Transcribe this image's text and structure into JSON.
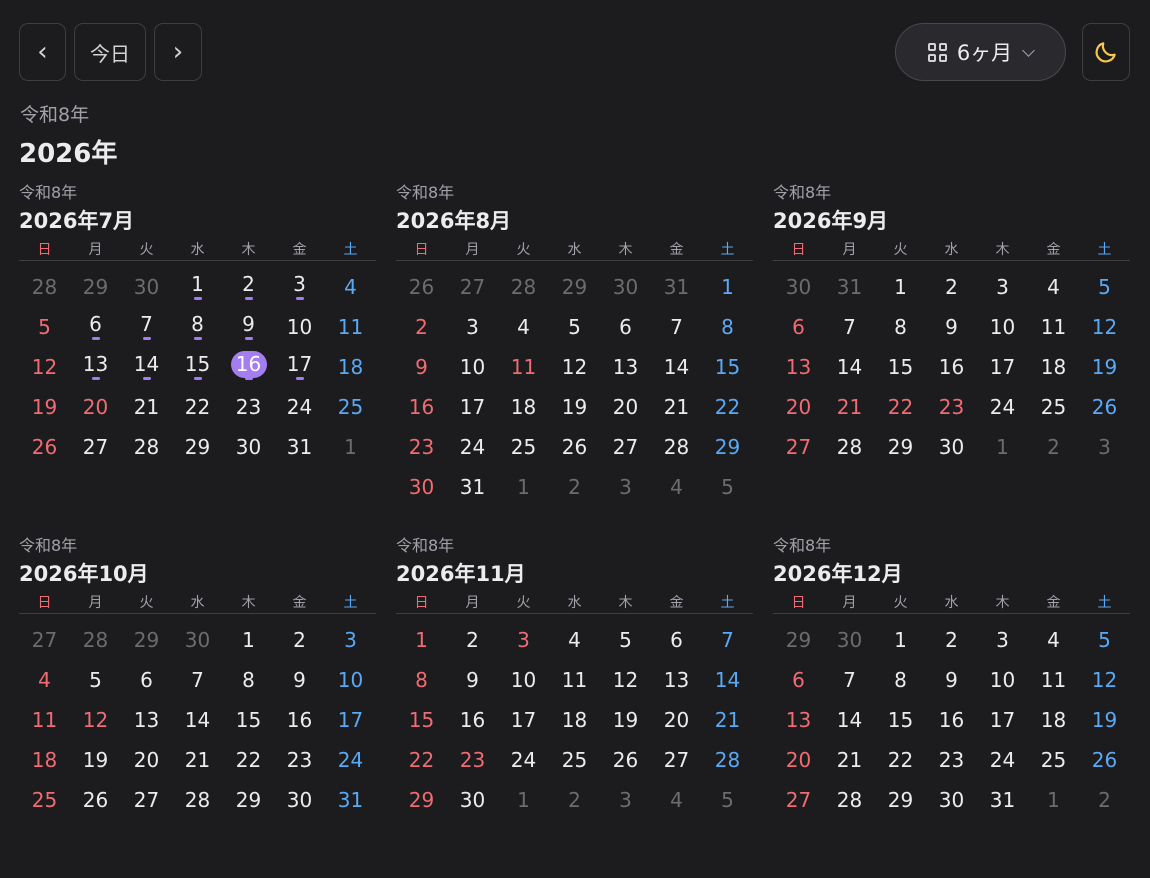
{
  "toolbar": {
    "prev_label": "‹",
    "today_label": "今日",
    "next_label": "›",
    "view_label": "6ヶ月",
    "view_icon": "grid-icon",
    "theme_icon": "moon-icon",
    "theme_icon_color": "#f5c84a"
  },
  "header": {
    "era": "令和8年",
    "year": "2026年"
  },
  "weekdays": [
    "日",
    "月",
    "火",
    "水",
    "木",
    "金",
    "土"
  ],
  "colors": {
    "sunday_holiday": "#f06b73",
    "saturday": "#5aa9f5",
    "accent": "#a47ef0",
    "background": "#1c1c1e"
  },
  "months": [
    {
      "era": "令和8年",
      "title": "2026年7月",
      "days": [
        {
          "d": "28",
          "t": "out"
        },
        {
          "d": "29",
          "t": "out"
        },
        {
          "d": "30",
          "t": "out"
        },
        {
          "d": "1",
          "t": "",
          "ev": true
        },
        {
          "d": "2",
          "t": "",
          "ev": true
        },
        {
          "d": "3",
          "t": "",
          "ev": true
        },
        {
          "d": "4",
          "t": "sat"
        },
        {
          "d": "5",
          "t": "sun"
        },
        {
          "d": "6",
          "t": "",
          "ev": true
        },
        {
          "d": "7",
          "t": "",
          "ev": true
        },
        {
          "d": "8",
          "t": "",
          "ev": true
        },
        {
          "d": "9",
          "t": "",
          "ev": true
        },
        {
          "d": "10",
          "t": ""
        },
        {
          "d": "11",
          "t": "sat"
        },
        {
          "d": "12",
          "t": "sun"
        },
        {
          "d": "13",
          "t": "",
          "ev": true
        },
        {
          "d": "14",
          "t": "",
          "ev": true
        },
        {
          "d": "15",
          "t": "",
          "ev": true
        },
        {
          "d": "16",
          "t": "today",
          "ev": true
        },
        {
          "d": "17",
          "t": "",
          "ev": true
        },
        {
          "d": "18",
          "t": "sat"
        },
        {
          "d": "19",
          "t": "sun"
        },
        {
          "d": "20",
          "t": "hol"
        },
        {
          "d": "21",
          "t": ""
        },
        {
          "d": "22",
          "t": ""
        },
        {
          "d": "23",
          "t": ""
        },
        {
          "d": "24",
          "t": ""
        },
        {
          "d": "25",
          "t": "sat"
        },
        {
          "d": "26",
          "t": "sun"
        },
        {
          "d": "27",
          "t": ""
        },
        {
          "d": "28",
          "t": ""
        },
        {
          "d": "29",
          "t": ""
        },
        {
          "d": "30",
          "t": ""
        },
        {
          "d": "31",
          "t": ""
        },
        {
          "d": "1",
          "t": "out"
        }
      ]
    },
    {
      "era": "令和8年",
      "title": "2026年8月",
      "days": [
        {
          "d": "26",
          "t": "out"
        },
        {
          "d": "27",
          "t": "out"
        },
        {
          "d": "28",
          "t": "out"
        },
        {
          "d": "29",
          "t": "out"
        },
        {
          "d": "30",
          "t": "out"
        },
        {
          "d": "31",
          "t": "out"
        },
        {
          "d": "1",
          "t": "sat"
        },
        {
          "d": "2",
          "t": "sun"
        },
        {
          "d": "3",
          "t": ""
        },
        {
          "d": "4",
          "t": ""
        },
        {
          "d": "5",
          "t": ""
        },
        {
          "d": "6",
          "t": ""
        },
        {
          "d": "7",
          "t": ""
        },
        {
          "d": "8",
          "t": "sat"
        },
        {
          "d": "9",
          "t": "sun"
        },
        {
          "d": "10",
          "t": ""
        },
        {
          "d": "11",
          "t": "hol"
        },
        {
          "d": "12",
          "t": ""
        },
        {
          "d": "13",
          "t": ""
        },
        {
          "d": "14",
          "t": ""
        },
        {
          "d": "15",
          "t": "sat"
        },
        {
          "d": "16",
          "t": "sun"
        },
        {
          "d": "17",
          "t": ""
        },
        {
          "d": "18",
          "t": ""
        },
        {
          "d": "19",
          "t": ""
        },
        {
          "d": "20",
          "t": ""
        },
        {
          "d": "21",
          "t": ""
        },
        {
          "d": "22",
          "t": "sat"
        },
        {
          "d": "23",
          "t": "sun"
        },
        {
          "d": "24",
          "t": ""
        },
        {
          "d": "25",
          "t": ""
        },
        {
          "d": "26",
          "t": ""
        },
        {
          "d": "27",
          "t": ""
        },
        {
          "d": "28",
          "t": ""
        },
        {
          "d": "29",
          "t": "sat"
        },
        {
          "d": "30",
          "t": "sun"
        },
        {
          "d": "31",
          "t": ""
        },
        {
          "d": "1",
          "t": "out"
        },
        {
          "d": "2",
          "t": "out"
        },
        {
          "d": "3",
          "t": "out"
        },
        {
          "d": "4",
          "t": "out"
        },
        {
          "d": "5",
          "t": "out"
        }
      ]
    },
    {
      "era": "令和8年",
      "title": "2026年9月",
      "days": [
        {
          "d": "30",
          "t": "out"
        },
        {
          "d": "31",
          "t": "out"
        },
        {
          "d": "1",
          "t": ""
        },
        {
          "d": "2",
          "t": ""
        },
        {
          "d": "3",
          "t": ""
        },
        {
          "d": "4",
          "t": ""
        },
        {
          "d": "5",
          "t": "sat"
        },
        {
          "d": "6",
          "t": "sun"
        },
        {
          "d": "7",
          "t": ""
        },
        {
          "d": "8",
          "t": ""
        },
        {
          "d": "9",
          "t": ""
        },
        {
          "d": "10",
          "t": ""
        },
        {
          "d": "11",
          "t": ""
        },
        {
          "d": "12",
          "t": "sat"
        },
        {
          "d": "13",
          "t": "sun"
        },
        {
          "d": "14",
          "t": ""
        },
        {
          "d": "15",
          "t": ""
        },
        {
          "d": "16",
          "t": ""
        },
        {
          "d": "17",
          "t": ""
        },
        {
          "d": "18",
          "t": ""
        },
        {
          "d": "19",
          "t": "sat"
        },
        {
          "d": "20",
          "t": "sun"
        },
        {
          "d": "21",
          "t": "hol"
        },
        {
          "d": "22",
          "t": "hol"
        },
        {
          "d": "23",
          "t": "hol"
        },
        {
          "d": "24",
          "t": ""
        },
        {
          "d": "25",
          "t": ""
        },
        {
          "d": "26",
          "t": "sat"
        },
        {
          "d": "27",
          "t": "sun"
        },
        {
          "d": "28",
          "t": ""
        },
        {
          "d": "29",
          "t": ""
        },
        {
          "d": "30",
          "t": ""
        },
        {
          "d": "1",
          "t": "out"
        },
        {
          "d": "2",
          "t": "out"
        },
        {
          "d": "3",
          "t": "out"
        }
      ]
    },
    {
      "era": "令和8年",
      "title": "2026年10月",
      "days": [
        {
          "d": "27",
          "t": "out"
        },
        {
          "d": "28",
          "t": "out"
        },
        {
          "d": "29",
          "t": "out"
        },
        {
          "d": "30",
          "t": "out"
        },
        {
          "d": "1",
          "t": ""
        },
        {
          "d": "2",
          "t": ""
        },
        {
          "d": "3",
          "t": "sat"
        },
        {
          "d": "4",
          "t": "sun"
        },
        {
          "d": "5",
          "t": ""
        },
        {
          "d": "6",
          "t": ""
        },
        {
          "d": "7",
          "t": ""
        },
        {
          "d": "8",
          "t": ""
        },
        {
          "d": "9",
          "t": ""
        },
        {
          "d": "10",
          "t": "sat"
        },
        {
          "d": "11",
          "t": "sun"
        },
        {
          "d": "12",
          "t": "hol"
        },
        {
          "d": "13",
          "t": ""
        },
        {
          "d": "14",
          "t": ""
        },
        {
          "d": "15",
          "t": ""
        },
        {
          "d": "16",
          "t": ""
        },
        {
          "d": "17",
          "t": "sat"
        },
        {
          "d": "18",
          "t": "sun"
        },
        {
          "d": "19",
          "t": ""
        },
        {
          "d": "20",
          "t": ""
        },
        {
          "d": "21",
          "t": ""
        },
        {
          "d": "22",
          "t": ""
        },
        {
          "d": "23",
          "t": ""
        },
        {
          "d": "24",
          "t": "sat"
        },
        {
          "d": "25",
          "t": "sun"
        },
        {
          "d": "26",
          "t": ""
        },
        {
          "d": "27",
          "t": ""
        },
        {
          "d": "28",
          "t": ""
        },
        {
          "d": "29",
          "t": ""
        },
        {
          "d": "30",
          "t": ""
        },
        {
          "d": "31",
          "t": "sat"
        }
      ]
    },
    {
      "era": "令和8年",
      "title": "2026年11月",
      "days": [
        {
          "d": "1",
          "t": "sun"
        },
        {
          "d": "2",
          "t": ""
        },
        {
          "d": "3",
          "t": "hol"
        },
        {
          "d": "4",
          "t": ""
        },
        {
          "d": "5",
          "t": ""
        },
        {
          "d": "6",
          "t": ""
        },
        {
          "d": "7",
          "t": "sat"
        },
        {
          "d": "8",
          "t": "sun"
        },
        {
          "d": "9",
          "t": ""
        },
        {
          "d": "10",
          "t": ""
        },
        {
          "d": "11",
          "t": ""
        },
        {
          "d": "12",
          "t": ""
        },
        {
          "d": "13",
          "t": ""
        },
        {
          "d": "14",
          "t": "sat"
        },
        {
          "d": "15",
          "t": "sun"
        },
        {
          "d": "16",
          "t": ""
        },
        {
          "d": "17",
          "t": ""
        },
        {
          "d": "18",
          "t": ""
        },
        {
          "d": "19",
          "t": ""
        },
        {
          "d": "20",
          "t": ""
        },
        {
          "d": "21",
          "t": "sat"
        },
        {
          "d": "22",
          "t": "sun"
        },
        {
          "d": "23",
          "t": "hol"
        },
        {
          "d": "24",
          "t": ""
        },
        {
          "d": "25",
          "t": ""
        },
        {
          "d": "26",
          "t": ""
        },
        {
          "d": "27",
          "t": ""
        },
        {
          "d": "28",
          "t": "sat"
        },
        {
          "d": "29",
          "t": "sun"
        },
        {
          "d": "30",
          "t": ""
        },
        {
          "d": "1",
          "t": "out"
        },
        {
          "d": "2",
          "t": "out"
        },
        {
          "d": "3",
          "t": "out"
        },
        {
          "d": "4",
          "t": "out"
        },
        {
          "d": "5",
          "t": "out"
        }
      ]
    },
    {
      "era": "令和8年",
      "title": "2026年12月",
      "days": [
        {
          "d": "29",
          "t": "out"
        },
        {
          "d": "30",
          "t": "out"
        },
        {
          "d": "1",
          "t": ""
        },
        {
          "d": "2",
          "t": ""
        },
        {
          "d": "3",
          "t": ""
        },
        {
          "d": "4",
          "t": ""
        },
        {
          "d": "5",
          "t": "sat"
        },
        {
          "d": "6",
          "t": "sun"
        },
        {
          "d": "7",
          "t": ""
        },
        {
          "d": "8",
          "t": ""
        },
        {
          "d": "9",
          "t": ""
        },
        {
          "d": "10",
          "t": ""
        },
        {
          "d": "11",
          "t": ""
        },
        {
          "d": "12",
          "t": "sat"
        },
        {
          "d": "13",
          "t": "sun"
        },
        {
          "d": "14",
          "t": ""
        },
        {
          "d": "15",
          "t": ""
        },
        {
          "d": "16",
          "t": ""
        },
        {
          "d": "17",
          "t": ""
        },
        {
          "d": "18",
          "t": ""
        },
        {
          "d": "19",
          "t": "sat"
        },
        {
          "d": "20",
          "t": "sun"
        },
        {
          "d": "21",
          "t": ""
        },
        {
          "d": "22",
          "t": ""
        },
        {
          "d": "23",
          "t": ""
        },
        {
          "d": "24",
          "t": ""
        },
        {
          "d": "25",
          "t": ""
        },
        {
          "d": "26",
          "t": "sat"
        },
        {
          "d": "27",
          "t": "sun"
        },
        {
          "d": "28",
          "t": ""
        },
        {
          "d": "29",
          "t": ""
        },
        {
          "d": "30",
          "t": ""
        },
        {
          "d": "31",
          "t": ""
        },
        {
          "d": "1",
          "t": "out"
        },
        {
          "d": "2",
          "t": "out"
        }
      ]
    }
  ]
}
